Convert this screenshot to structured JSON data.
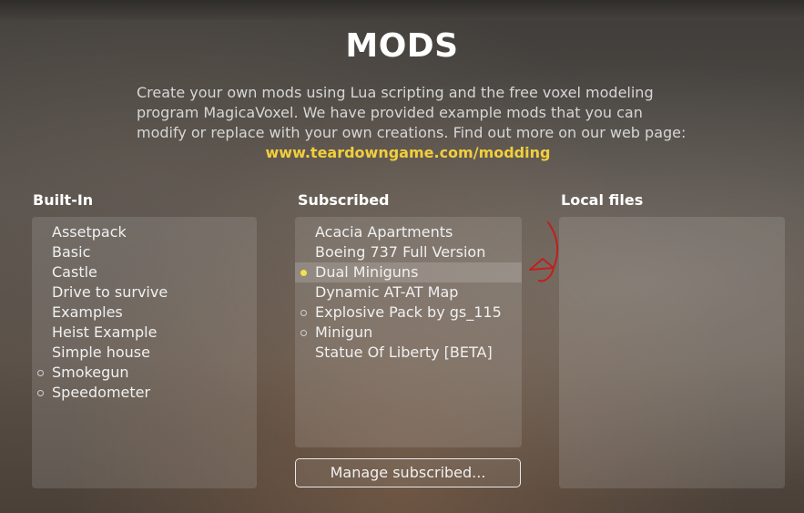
{
  "title": "MODS",
  "description": [
    "Create your own mods using Lua scripting and the free voxel modeling",
    "program MagicaVoxel. We have provided example mods that you can",
    "modify or replace with your own creations. Find out more on our web page:"
  ],
  "link": "www.teardowngame.com/modding",
  "columns": {
    "builtin": {
      "title": "Built-In",
      "items": [
        {
          "label": "Assetpack",
          "state": "none"
        },
        {
          "label": "Basic",
          "state": "none"
        },
        {
          "label": "Castle",
          "state": "none"
        },
        {
          "label": "Drive to survive",
          "state": "none"
        },
        {
          "label": "Examples",
          "state": "none"
        },
        {
          "label": "Heist Example",
          "state": "none"
        },
        {
          "label": "Simple house",
          "state": "none"
        },
        {
          "label": "Smokegun",
          "state": "disabled"
        },
        {
          "label": "Speedometer",
          "state": "disabled"
        }
      ]
    },
    "subscribed": {
      "title": "Subscribed",
      "items": [
        {
          "label": "Acacia Apartments",
          "state": "none"
        },
        {
          "label": "Boeing 737 Full Version",
          "state": "none"
        },
        {
          "label": "Dual Miniguns",
          "state": "enabled",
          "selected": true
        },
        {
          "label": "Dynamic AT-AT Map",
          "state": "none"
        },
        {
          "label": "Explosive Pack by gs_115",
          "state": "disabled"
        },
        {
          "label": "Minigun",
          "state": "disabled"
        },
        {
          "label": "Statue Of Liberty [BETA]",
          "state": "none"
        }
      ]
    },
    "local": {
      "title": "Local files",
      "items": []
    }
  },
  "manage_button": "Manage subscribed...",
  "colors": {
    "link": "#f2cf3c",
    "enabled_dot": "#f2e14a",
    "annotation_arrow": "#c0201e"
  }
}
